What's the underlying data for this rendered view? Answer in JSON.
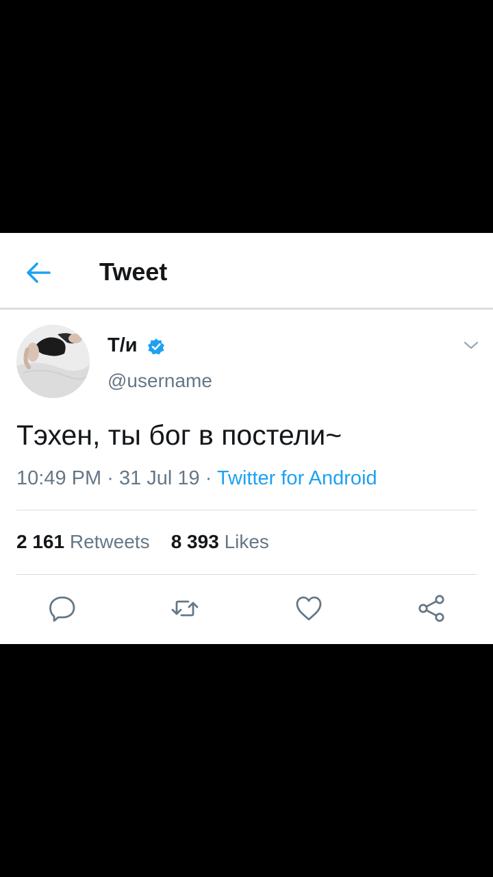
{
  "header": {
    "title": "Tweet",
    "back_icon": "arrow-left-icon"
  },
  "tweet": {
    "display_name": "Т/и",
    "username": "@username",
    "text": "Тэхен, ты бог в постели~",
    "time": "10:49 PM",
    "date": "31 Jul 19",
    "separator": "·",
    "source": "Twitter for Android",
    "verified": true
  },
  "stats": {
    "retweets_count": "2 161",
    "retweets_label": "Retweets",
    "likes_count": "8 393",
    "likes_label": "Likes"
  },
  "actions": [
    "reply-icon",
    "retweet-icon",
    "like-icon",
    "share-icon"
  ],
  "colors": {
    "accent": "#1da1f2",
    "text_primary": "#14171a",
    "text_secondary": "#657786",
    "divider": "#d9dde1"
  }
}
